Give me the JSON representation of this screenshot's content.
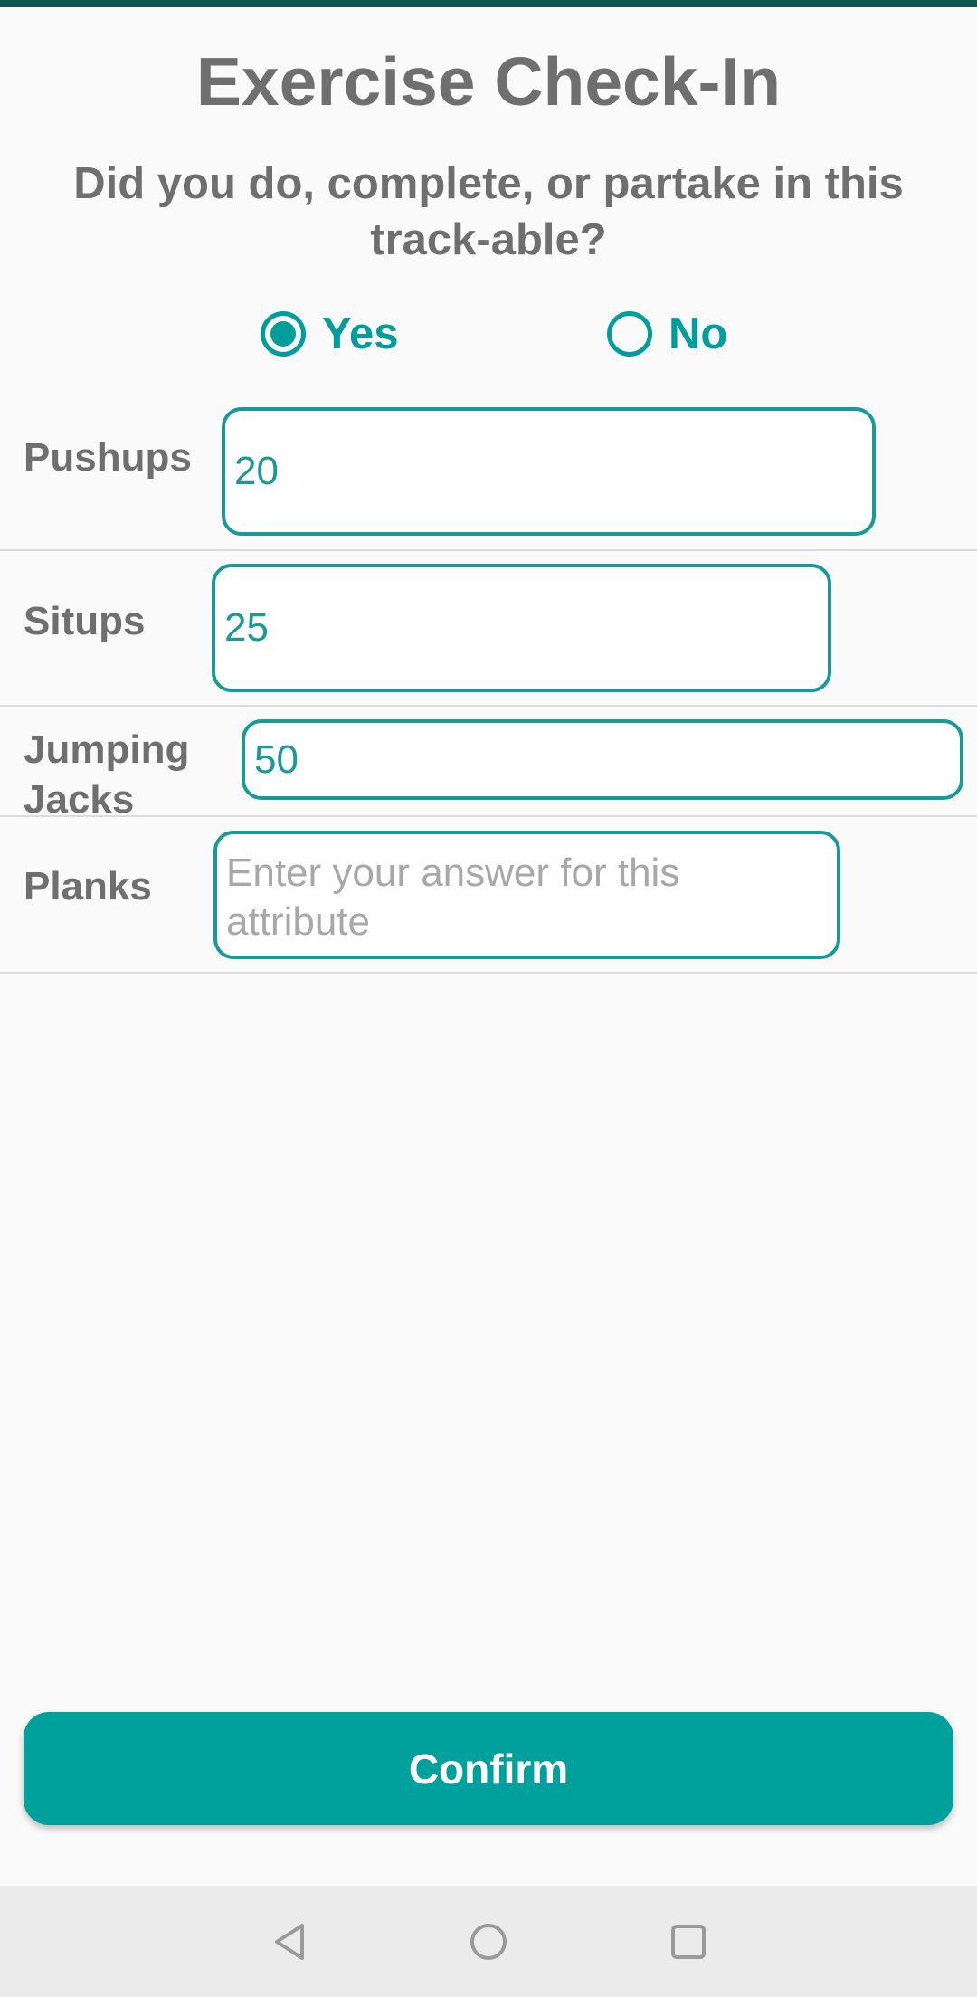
{
  "header": {
    "title": "Exercise Check-In"
  },
  "question": {
    "text": "Did you do, complete, or partake in this track-able?"
  },
  "radio": {
    "yes_label": "Yes",
    "no_label": "No",
    "selected": "Yes"
  },
  "fields": [
    {
      "label": "Pushups",
      "value": "20",
      "placeholder": "Enter your answer for this attribute"
    },
    {
      "label": "Situps",
      "value": "25",
      "placeholder": "Enter your answer for this attribute"
    },
    {
      "label": "Jumping Jacks",
      "value": "50",
      "placeholder": "Enter your answer for this attribute"
    },
    {
      "label": "Planks",
      "value": "",
      "placeholder": "Enter your answer for this attribute"
    }
  ],
  "confirm": {
    "label": "Confirm"
  },
  "nav_bar": {
    "back_icon": "back-triangle-icon",
    "home_icon": "home-circle-icon",
    "recent_icon": "recent-apps-square-icon"
  },
  "colors": {
    "accent": "#009e9b",
    "top_strip": "#0b5a4f",
    "text_gray": "#6f6f6f",
    "placeholder_gray": "#a8a8a8",
    "background": "#fafafa",
    "nav_bar": "#ebebeb"
  }
}
